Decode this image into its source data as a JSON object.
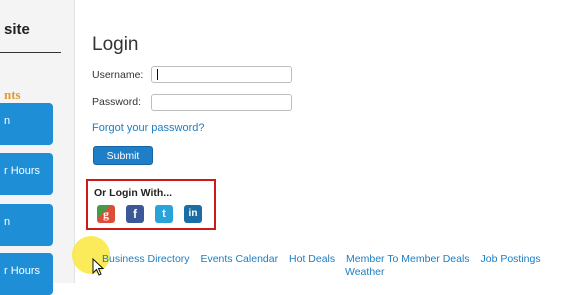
{
  "sidebar": {
    "site_title": "site",
    "heading": "nts",
    "buttons": [
      "n",
      "r Hours",
      "n",
      "r Hours"
    ]
  },
  "login": {
    "heading": "Login",
    "username_label": "Username:",
    "username_value": "",
    "password_label": "Password:",
    "password_value": "",
    "forgot_link": "Forgot your password?",
    "submit_label": "Submit"
  },
  "social": {
    "label": "Or Login With...",
    "icons": [
      "google-icon",
      "facebook-icon",
      "twitter-icon",
      "linkedin-icon"
    ],
    "glyphs": {
      "google": "g",
      "facebook": "f",
      "twitter": "t",
      "linkedin": "in"
    },
    "box_border_color": "#cc1a1a"
  },
  "footer": {
    "links": [
      "Business Directory",
      "Events Calendar",
      "Hot Deals",
      "Member To Member Deals",
      "Job Postings"
    ],
    "weather": "Weather"
  },
  "colors": {
    "link": "#1d7ec2",
    "button": "#1e7ec8",
    "side_button": "#1e8fd6",
    "accent": "#e39a2b"
  }
}
